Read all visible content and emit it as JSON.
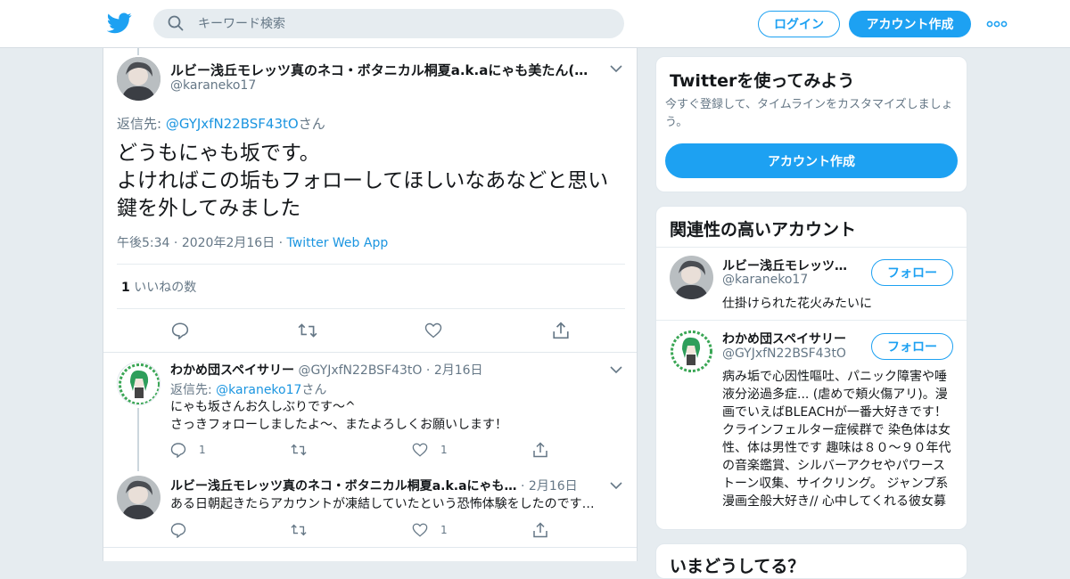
{
  "header": {
    "search_placeholder": "キーワード検索",
    "login_label": "ログイン",
    "signup_label": "アカウント作成"
  },
  "main_tweet": {
    "name": "ルビー浅丘モレッツ真のネコ・ボタニカル桐夏a.k.aにゃも美たん(イ…",
    "handle": "@karaneko17",
    "reply_prefix": "返信先: ",
    "reply_to": "@GYJxfN22BSF43tO",
    "reply_suffix": "さん",
    "text": "どうもにゃも坂です。\nよければこの垢もフォローしてほしいなあなどと思い鍵を外してみました",
    "time": "午後5:34",
    "date": "2020年2月16日",
    "source": "Twitter Web App",
    "likes_count": "1",
    "likes_label": "いいねの数"
  },
  "replies": [
    {
      "name": "わかめ団スペイサリー",
      "handle": "@GYJxfN22BSF43tO",
      "date": "2月16日",
      "reply_prefix": "返信先: ",
      "reply_to": "@karaneko17",
      "reply_suffix": "さん",
      "text": "にゃも坂さんお久しぶりです～^\nさっきフォローしましたよ～、またよろしくお願いします！",
      "reply_count": "1",
      "like_count": "1"
    },
    {
      "name": "ルビー浅丘モレッツ真のネコ・ボタニカル桐夏a.k.aにゃも…",
      "date": "2月16日",
      "text": "ある日朝起きたらアカウントが凍結していたという恐怖体験をしたのです…",
      "like_count": "1"
    }
  ],
  "signup_card": {
    "title": "Twitterを使ってみよう",
    "description": "今すぐ登録して、タイムラインをカスタマイズしましょう。",
    "button_label": "アカウント作成"
  },
  "related_card": {
    "title": "関連性の高いアカウント",
    "accounts": [
      {
        "name": "ルビー浅丘モレッツ…",
        "handle": "@karaneko17",
        "bio": "仕掛けられた花火みたいに",
        "follow_label": "フォロー"
      },
      {
        "name": "わかめ団スペイサリー",
        "handle": "@GYJxfN22BSF43tO",
        "bio": "病み垢で心因性嘔吐、パニック障害や唾液分泌過多症... (虐めで頬火傷アリ)。漫画でいえばBLEACHが一番大好きです！クラインフェルター症候群で 染色体は女性、体は男性です 趣味は８０～９０年代の音楽鑑賞、シルバーアクセやパワーストーン収集、サイクリング。 ジャンプ系漫画全般大好き// 心中してくれる彼女募集...",
        "follow_label": "フォロー"
      }
    ]
  },
  "trends_card": {
    "title": "いまどうしてる？"
  },
  "colors": {
    "accent": "#1da1f2",
    "link": "#1b95e0",
    "background": "#e6ecf0",
    "muted": "#657786"
  }
}
